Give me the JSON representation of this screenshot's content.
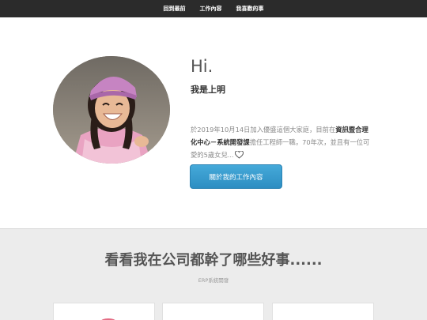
{
  "nav": {
    "items": [
      {
        "label": "回到最前"
      },
      {
        "label": "工作內容"
      },
      {
        "label": "我喜歡的事"
      }
    ]
  },
  "hero": {
    "greeting": "Hi.",
    "name": "我是上明",
    "intro_part1": "於2019年10月14日加入優盛這個大家庭，目前在",
    "intro_bold": "資訊暨合理化中心－系統開發課",
    "intro_part2": "擔任工程師一職，70年次，並且有一位可愛的5歲女兒...",
    "button_label": "關於我的工作內容",
    "accent_color": "#3a9ed0"
  },
  "section": {
    "title": "看看我在公司都幹了哪些好事......",
    "subtitle": "ERP系統開發"
  }
}
